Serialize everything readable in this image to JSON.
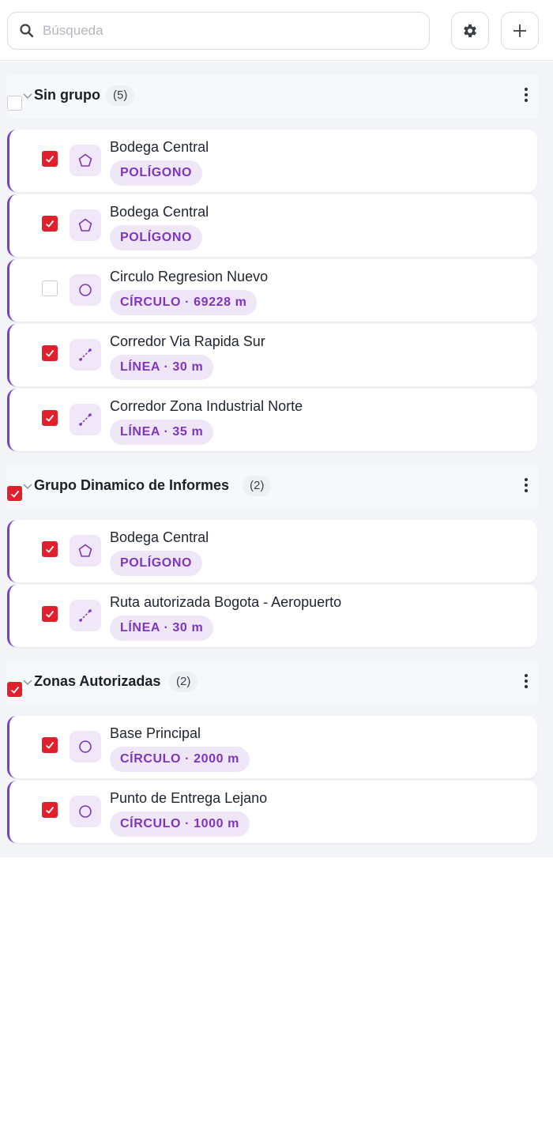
{
  "search": {
    "placeholder": "Búsqueda",
    "icon": "search-icon"
  },
  "toolbar": {
    "settings_icon": "gear-icon",
    "add_icon": "plus-icon"
  },
  "colors": {
    "accent": "#7b3fc4",
    "check": "#e0202c",
    "tag_bg": "#efe6f8",
    "tag_text": "#7e35c0"
  },
  "groups": [
    {
      "title": "Sin grupo",
      "count": "(5)",
      "checked": false,
      "items": [
        {
          "name": "Bodega Central",
          "tag": "POLÍGONO",
          "shape": "polygon",
          "checked": true
        },
        {
          "name": "Bodega Central",
          "tag": "POLÍGONO",
          "shape": "polygon",
          "checked": true
        },
        {
          "name": "Circulo Regresion Nuevo",
          "tag": "CÍRCULO · 69228 m",
          "shape": "circle",
          "checked": false
        },
        {
          "name": "Corredor Via Rapida Sur",
          "tag": "LÍNEA · 30 m",
          "shape": "line",
          "checked": true
        },
        {
          "name": "Corredor Zona Industrial Norte",
          "tag": "LÍNEA · 35 m",
          "shape": "line",
          "checked": true
        }
      ]
    },
    {
      "title": "Grupo Dinamico de Informes",
      "count": "(2)",
      "checked": true,
      "items": [
        {
          "name": "Bodega Central",
          "tag": "POLÍGONO",
          "shape": "polygon",
          "checked": true
        },
        {
          "name": "Ruta autorizada Bogota - Aeropuerto",
          "tag": "LÍNEA · 30 m",
          "shape": "line",
          "checked": true
        }
      ]
    },
    {
      "title": "Zonas Autorizadas",
      "count": "(2)",
      "checked": true,
      "items": [
        {
          "name": "Base Principal",
          "tag": "CÍRCULO · 2000 m",
          "shape": "circle",
          "checked": true
        },
        {
          "name": "Punto de Entrega Lejano",
          "tag": "CÍRCULO · 1000 m",
          "shape": "circle",
          "checked": true
        }
      ]
    }
  ]
}
